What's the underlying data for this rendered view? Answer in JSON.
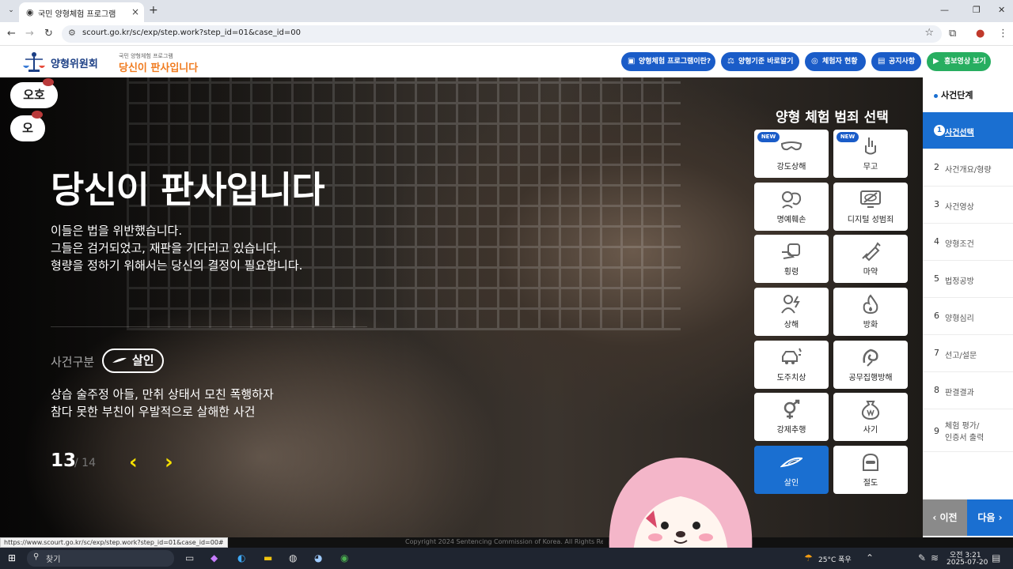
{
  "browser": {
    "tab_title": "국민 양형체험 프로그램",
    "url": "scourt.go.kr/sc/exp/step.work?step_id=01&case_id=00",
    "status_url": "https://www.scourt.go.kr/sc/exp/step.work?step_id=01&case_id=00#"
  },
  "header": {
    "logo_text": "양형위원회",
    "logo_sub_small": "국민 양형체험 프로그램",
    "logo_sub": "당신이 판사입니다",
    "buttons": [
      "양형체험 프로그램이란?",
      "양형기준 바로알기",
      "체험자 현황",
      "공지사항",
      "홍보영상 보기"
    ]
  },
  "stickers": [
    "오호",
    "오"
  ],
  "hero": {
    "title": "당신이 판사입니다",
    "desc": [
      "이들은 법을 위반했습니다.",
      "그들은 검거되었고, 재판을 기다리고 있습니다.",
      "형량을 정하기 위해서는 당신의 결정이 필요합니다."
    ],
    "case_label": "사건구분",
    "case_type": "살인",
    "case_desc": [
      "상습 술주정 아들, 만취 상태서 모친 폭행하자",
      "참다 못한 부친이 우발적으로 살해한 사건"
    ],
    "page_current": "13",
    "page_total": "/ 14"
  },
  "crime_panel": {
    "title": "양형 체험 범죄 선택",
    "new_badge": "NEW",
    "items": [
      {
        "label": "강도상해",
        "icon": "mask-icon",
        "new": true
      },
      {
        "label": "무고",
        "icon": "pointing-hand-icon",
        "new": true
      },
      {
        "label": "명예훼손",
        "icon": "theater-masks-icon",
        "new": false
      },
      {
        "label": "디지털 성범죄",
        "icon": "monitor-eye-slash-icon",
        "new": false
      },
      {
        "label": "횡령",
        "icon": "money-hand-icon",
        "new": false
      },
      {
        "label": "마약",
        "icon": "syringe-icon",
        "new": false
      },
      {
        "label": "상해",
        "icon": "injured-person-icon",
        "new": false
      },
      {
        "label": "방화",
        "icon": "fire-icon",
        "new": false
      },
      {
        "label": "도주치상",
        "icon": "car-crash-icon",
        "new": false
      },
      {
        "label": "공무집행방해",
        "icon": "obstruction-icon",
        "new": false
      },
      {
        "label": "강제추행",
        "icon": "gender-icon",
        "new": false
      },
      {
        "label": "사기",
        "icon": "money-bag-icon",
        "new": false
      },
      {
        "label": "살인",
        "icon": "knife-icon",
        "new": false
      },
      {
        "label": "절도",
        "icon": "thief-mask-icon",
        "new": false
      }
    ],
    "selected": "살인"
  },
  "steps": {
    "heading": "사건단계",
    "items": [
      {
        "num": "1",
        "label": "사건선택"
      },
      {
        "num": "2",
        "label": "사건개요/형량"
      },
      {
        "num": "3",
        "label": "사건영상"
      },
      {
        "num": "4",
        "label": "양형조건"
      },
      {
        "num": "5",
        "label": "법정공방"
      },
      {
        "num": "6",
        "label": "양형심리"
      },
      {
        "num": "7",
        "label": "선고/설문"
      },
      {
        "num": "8",
        "label": "판결결과"
      },
      {
        "num": "9",
        "label_lines": [
          "체험 평가/",
          "인증서 출력"
        ]
      }
    ],
    "active": "1",
    "prev": "이전",
    "next": "다음"
  },
  "copyright": "Copyright 2024 Sentencing Commission of Korea. All Rights Reserved.",
  "taskbar": {
    "search": "찾기",
    "weather": "25°C 폭우",
    "time": "오전 3:21",
    "date": "2025-07-20"
  },
  "colors": {
    "primary": "#1a6fd1",
    "header_button": "#1a5cc8",
    "green_button": "#27ae60",
    "accent_arrow": "#f5e000",
    "logo_orange": "#f07b1f"
  }
}
